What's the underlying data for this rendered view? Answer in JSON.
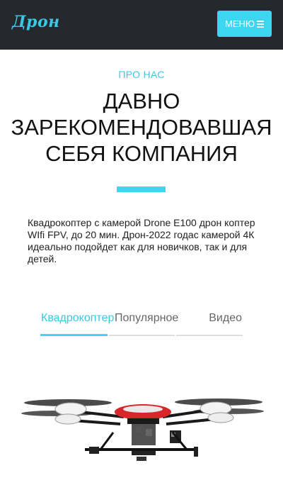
{
  "navbar": {
    "logo": "Дрон",
    "menu_label": "МЕНЮ"
  },
  "about": {
    "eyebrow": "ПРО НАС",
    "headline_lines": [
      "ДАВНО",
      "ЗАРЕКОМЕНДОВАВШАЯ",
      "СЕБЯ КОМПАНИЯ"
    ],
    "intro": "Квадрокоптер с камерой Drone E100 дрон коптер WIfi FPV, до 20 мин. Дрон-2022 годас камерой 4К идеально подойдет как для новичков, так и для детей."
  },
  "tabs": [
    {
      "label": "Квадрокоптер",
      "active": true
    },
    {
      "label": "Популярное",
      "active": false
    },
    {
      "label": "Видео",
      "active": false
    }
  ],
  "colors": {
    "accent": "#3cd6f0",
    "navbar_bg": "#25282c",
    "drone_body": "#d8272a"
  },
  "icons": {
    "menu": "hamburger-icon"
  }
}
